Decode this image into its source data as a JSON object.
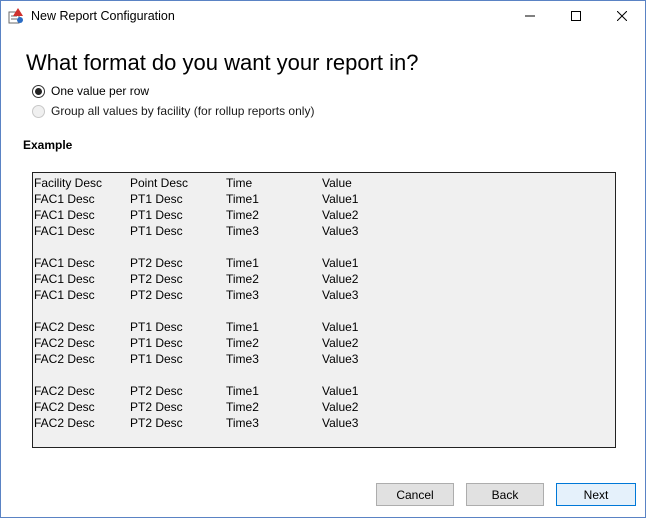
{
  "window": {
    "title": "New Report Configuration"
  },
  "heading": "What format do you want your report in?",
  "options": [
    {
      "label": "One value per row",
      "checked": true,
      "enabled": true
    },
    {
      "label": "Group all values by facility (for rollup reports only)",
      "checked": false,
      "enabled": false
    }
  ],
  "example": {
    "label": "Example",
    "columns": [
      "Facility Desc",
      "Point Desc",
      "Time",
      "Value"
    ],
    "groups": [
      [
        [
          "FAC1 Desc",
          "PT1 Desc",
          "Time1",
          "Value1"
        ],
        [
          "FAC1 Desc",
          "PT1 Desc",
          "Time2",
          "Value2"
        ],
        [
          "FAC1 Desc",
          "PT1 Desc",
          "Time3",
          "Value3"
        ]
      ],
      [
        [
          "FAC1 Desc",
          "PT2 Desc",
          "Time1",
          "Value1"
        ],
        [
          "FAC1 Desc",
          "PT2 Desc",
          "Time2",
          "Value2"
        ],
        [
          "FAC1 Desc",
          "PT2 Desc",
          "Time3",
          "Value3"
        ]
      ],
      [
        [
          "FAC2 Desc",
          "PT1 Desc",
          "Time1",
          "Value1"
        ],
        [
          "FAC2 Desc",
          "PT1 Desc",
          "Time2",
          "Value2"
        ],
        [
          "FAC2 Desc",
          "PT1 Desc",
          "Time3",
          "Value3"
        ]
      ],
      [
        [
          "FAC2 Desc",
          "PT2 Desc",
          "Time1",
          "Value1"
        ],
        [
          "FAC2 Desc",
          "PT2 Desc",
          "Time2",
          "Value2"
        ],
        [
          "FAC2 Desc",
          "PT2 Desc",
          "Time3",
          "Value3"
        ]
      ]
    ]
  },
  "buttons": {
    "cancel": "Cancel",
    "back": "Back",
    "next": "Next"
  },
  "icons": {
    "app": "report-config-icon",
    "minimize": "minimize-icon",
    "maximize": "maximize-icon",
    "close": "close-icon"
  },
  "colors": {
    "accent": "#0078d7",
    "window_border": "#5a83c4",
    "example_bg": "#f0f0f0"
  }
}
